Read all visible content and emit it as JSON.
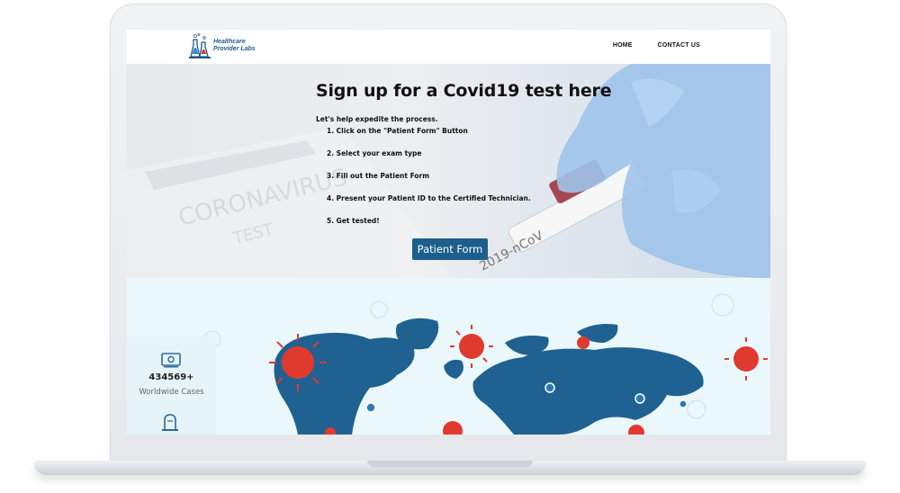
{
  "brand": {
    "line1": "Healthcare",
    "line2": "Provider Labs"
  },
  "nav": {
    "home": "HOME",
    "contact": "CONTACT US"
  },
  "hero": {
    "title": "Sign up for a Covid19 test here",
    "intro": "Let's help expedite the process.",
    "steps": [
      "1. Click on the \"Patient Form\" Button",
      "2. Select your exam type",
      "3. Fill out the Patient Form",
      "4. Present your Patient ID to the Certified Technician.",
      "5. Get tested!"
    ],
    "button_label": "Patient Form"
  },
  "stats": {
    "cases_value": "434569+",
    "cases_label": "Worldwide Cases"
  },
  "colors": {
    "brand_blue": "#1d5f8c",
    "map_blue": "#1f6191",
    "virus_red": "#e03a2f",
    "stats_bg": "#eaf8fb"
  },
  "icons": [
    "flask-logo-icon",
    "money-icon",
    "tombstone-icon",
    "virus-icon",
    "map-pin-icon"
  ]
}
